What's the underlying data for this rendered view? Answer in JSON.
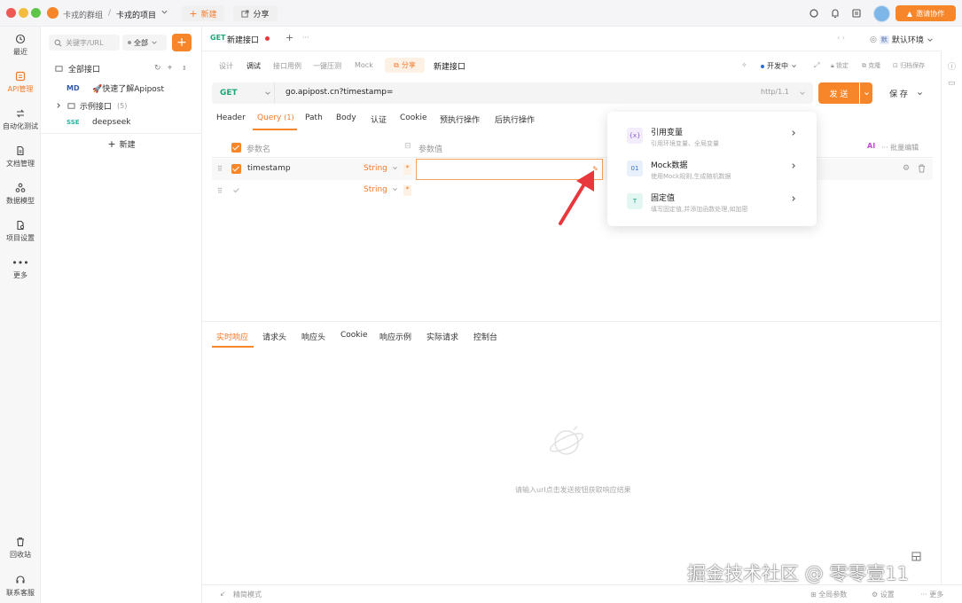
{
  "topbar": {
    "team": "卡戎的群组",
    "separator": "/",
    "project": "卡戎的项目",
    "new_label": "新建",
    "share_label": "分享",
    "invite_label": "邀请协作"
  },
  "rail": {
    "items": [
      {
        "label": "最近",
        "icon": "clock-icon"
      },
      {
        "label": "API管理",
        "icon": "api-icon"
      },
      {
        "label": "自动化测试",
        "icon": "automation-icon"
      },
      {
        "label": "文档管理",
        "icon": "document-icon"
      },
      {
        "label": "数据模型",
        "icon": "model-icon"
      },
      {
        "label": "项目设置",
        "icon": "settings-icon"
      },
      {
        "label": "更多",
        "icon": "more-icon"
      }
    ],
    "bottom": [
      {
        "label": "回收站",
        "icon": "trash-icon"
      },
      {
        "label": "联系客服",
        "icon": "headset-icon"
      }
    ]
  },
  "sidebar": {
    "search_placeholder": "关键字/URL",
    "filter_label": "全部",
    "all_apis": "全部接口",
    "items": [
      {
        "badge": "MD",
        "label": "🚀快速了解Apipost"
      },
      {
        "badge": "",
        "label": "示例接口",
        "count": "(5)"
      },
      {
        "badge": "SSE",
        "label": "deepseek"
      }
    ],
    "new_label": "新建"
  },
  "request": {
    "tab_method": "GET",
    "tab_title": "新建接口",
    "env_label": "默认环境",
    "mode_tabs": [
      "设计",
      "调试",
      "接口用例",
      "一键压测",
      "Mock"
    ],
    "share_label": "分享",
    "name": "新建接口",
    "status_label": "开发中",
    "lock_label": "锁定",
    "clone_label": "克隆",
    "archive_label": "归档保存",
    "method": "GET",
    "url": "go.apipost.cn?timestamp=",
    "protocol": "http/1.1",
    "send_label": "发 送",
    "save_label": "保 存"
  },
  "param_tabs": {
    "header": "Header",
    "query": "Query",
    "query_count": "(1)",
    "path": "Path",
    "body": "Body",
    "auth": "认证",
    "cookie": "Cookie",
    "pre": "预执行操作",
    "post": "后执行操作"
  },
  "table": {
    "col_name": "参数名",
    "col_value": "参数值",
    "ai_label": "AI",
    "batch_label": "批量编辑",
    "rows": [
      {
        "name": "timestamp",
        "type": "String",
        "required": "*",
        "value": ""
      },
      {
        "name": "",
        "type": "String",
        "required": "*",
        "value": ""
      }
    ]
  },
  "popup": {
    "items": [
      {
        "title": "引用变量",
        "desc": "引用环境变量、全局变量",
        "icon": "variable-icon",
        "glyph": "{x}"
      },
      {
        "title": "Mock数据",
        "desc": "使用Mock规则,生成随机数据",
        "icon": "mock-icon",
        "glyph": "01"
      },
      {
        "title": "固定值",
        "desc": "填写固定值,并添加函数处理,如加密",
        "icon": "fixed-value-icon",
        "glyph": "T"
      }
    ]
  },
  "response": {
    "tabs": [
      "实时响应",
      "请求头",
      "响应头",
      "Cookie",
      "响应示例",
      "实际请求",
      "控制台"
    ],
    "empty_text": "请输入url点击发送按钮获取响应结果"
  },
  "statusbar": {
    "mode": "精简模式",
    "global_params": "全局参数",
    "settings": "设置",
    "more": "更多"
  },
  "watermark": "掘金技术社区 @ 零零壹11",
  "colors": {
    "accent": "#f7862b",
    "get_method": "#1aa77a",
    "arrow": "#e8383d"
  }
}
